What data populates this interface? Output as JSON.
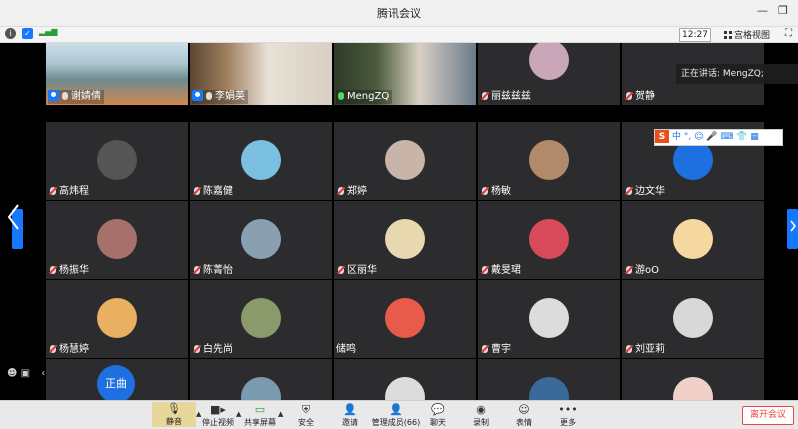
{
  "window": {
    "title": "腾讯会议",
    "minimize": "—",
    "restore": "❐"
  },
  "infobar": {
    "clock": "12:27",
    "grid_view_label": "宫格视图",
    "signal": "▂▄▆"
  },
  "speaking": {
    "label": "正在讲话: MengZQ;"
  },
  "ime": {
    "logo": "S",
    "items": "中 °, ☺ 🎤 ⌨ 👕 ▦"
  },
  "participants": [
    {
      "name": "谢婧倩",
      "mic": "on",
      "host": true,
      "video": true,
      "avatar": "#5a8a6a"
    },
    {
      "name": "李娟英",
      "mic": "on",
      "host": true,
      "video": true,
      "avatar": "#b89a80"
    },
    {
      "name": "MengZQ",
      "mic": "live",
      "host": false,
      "video": true,
      "avatar": "#4a5a4a"
    },
    {
      "name": "丽兹兹兹",
      "mic": "off",
      "host": false,
      "video": false,
      "avatar": "#c9a6b8"
    },
    {
      "name": "贺静",
      "mic": "off",
      "host": false,
      "video": false,
      "avatar": ""
    },
    {
      "name": "高炜程",
      "mic": "off",
      "host": false,
      "video": false,
      "avatar": "#555555"
    },
    {
      "name": "陈嘉健",
      "mic": "off",
      "host": false,
      "video": false,
      "avatar": "#7cc0e0"
    },
    {
      "name": "郑婷",
      "mic": "off",
      "host": false,
      "video": false,
      "avatar": "#c8b4a8"
    },
    {
      "name": "杨敏",
      "mic": "off",
      "host": false,
      "video": false,
      "avatar": "#b08a6a"
    },
    {
      "name": "边文华",
      "mic": "off",
      "host": false,
      "video": false,
      "avatar": "#1e6fe0"
    },
    {
      "name": "杨振华",
      "mic": "off",
      "host": false,
      "video": false,
      "avatar": "#a8706a"
    },
    {
      "name": "陈菁怡",
      "mic": "off",
      "host": false,
      "video": false,
      "avatar": "#8aa0b0"
    },
    {
      "name": "区丽华",
      "mic": "off",
      "host": false,
      "video": false,
      "avatar": "#e8d8b0"
    },
    {
      "name": "戴旻珺",
      "mic": "off",
      "host": false,
      "video": false,
      "avatar": "#d84a5a"
    },
    {
      "name": "游oO",
      "mic": "off",
      "host": false,
      "video": false,
      "avatar": "#f4d8a0"
    },
    {
      "name": "杨慧婷",
      "mic": "off",
      "host": false,
      "video": false,
      "avatar": "#e8b060"
    },
    {
      "name": "白先尚",
      "mic": "off",
      "host": false,
      "video": false,
      "avatar": "#8a9a6a"
    },
    {
      "name": "储鸣",
      "mic": "none",
      "host": false,
      "video": false,
      "avatar": "#e85a4a"
    },
    {
      "name": "曹宇",
      "mic": "off",
      "host": false,
      "video": false,
      "avatar": "#dcdcdc"
    },
    {
      "name": "刘亚莉",
      "mic": "off",
      "host": false,
      "video": false,
      "avatar": "#d8d8d8"
    },
    {
      "name": "",
      "mic": "none",
      "host": false,
      "video": false,
      "avatar": ""
    },
    {
      "name": "",
      "mic": "none",
      "host": false,
      "video": false,
      "avatar": "#7a9ab0"
    },
    {
      "name": "",
      "mic": "none",
      "host": false,
      "video": false,
      "avatar": "#dcdcdc"
    },
    {
      "name": "",
      "mic": "none",
      "host": false,
      "video": false,
      "avatar": "#3a6a9a"
    },
    {
      "name": "",
      "mic": "none",
      "host": false,
      "video": false,
      "avatar": "#f0d0c8"
    }
  ],
  "zhengqu_avatar": "正曲",
  "toolbar": {
    "mute": "静音",
    "stop_video": "停止视频",
    "share": "共享屏幕",
    "security": "安全",
    "invite": "邀请",
    "members": "管理成员(66)",
    "chat": "聊天",
    "record": "录制",
    "reactions": "表情",
    "more": "更多",
    "leave": "离开会议"
  }
}
